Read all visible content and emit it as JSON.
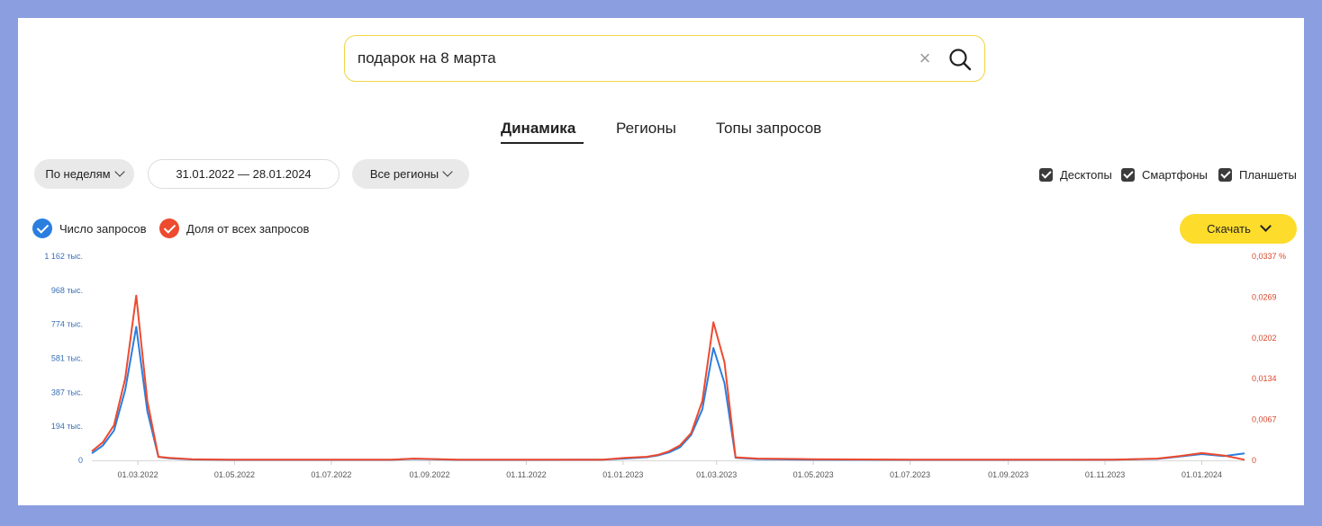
{
  "search": {
    "value": "подарок на 8 марта",
    "clear_symbol": "×"
  },
  "tabs": [
    {
      "label": "Динамика",
      "active": true
    },
    {
      "label": "Регионы",
      "active": false
    },
    {
      "label": "Топы запросов",
      "active": false
    }
  ],
  "filters": {
    "period_label": "По неделям",
    "date_range": "31.01.2022 — 28.01.2024",
    "region_label": "Все регионы"
  },
  "devices": [
    {
      "label": "Десктопы",
      "checked": true
    },
    {
      "label": "Смартфоны",
      "checked": true
    },
    {
      "label": "Планшеты",
      "checked": true
    }
  ],
  "legend": [
    {
      "label": "Число запросов",
      "color": "#2a7ee0"
    },
    {
      "label": "Доля от всех запросов",
      "color": "#ed4a2f"
    }
  ],
  "download_label": "Скачать",
  "chart_data": {
    "type": "line",
    "x_ticks": [
      "01.03.2022",
      "01.05.2022",
      "01.07.2022",
      "01.09.2022",
      "01.11.2022",
      "01.01.2023",
      "01.03.2023",
      "01.05.2023",
      "01.07.2023",
      "01.09.2023",
      "01.11.2023",
      "01.01.2024"
    ],
    "y_left_ticks": [
      "0",
      "194 тыс.",
      "387 тыс.",
      "581 тыс.",
      "774 тыс.",
      "968 тыс.",
      "1 162 тыс."
    ],
    "y_right_ticks": [
      "0",
      "0,0067",
      "0,0134",
      "0,0202",
      "0,0269",
      "0,0337 %"
    ],
    "y_left_range": [
      0,
      1162
    ],
    "y_right_range": [
      0,
      0.0337
    ],
    "x_range": [
      "2022-01-31",
      "2024-01-28"
    ],
    "series": [
      {
        "name": "Число запросов",
        "axis": "left",
        "color": "#2a7ee0",
        "x": [
          "2022-01-31",
          "2022-02-07",
          "2022-02-14",
          "2022-02-21",
          "2022-02-28",
          "2022-03-07",
          "2022-03-14",
          "2022-03-21",
          "2022-04-04",
          "2022-05-02",
          "2022-06-27",
          "2022-08-08",
          "2022-08-22",
          "2022-09-19",
          "2022-11-14",
          "2022-12-19",
          "2023-01-02",
          "2023-01-16",
          "2023-01-23",
          "2023-01-30",
          "2023-02-06",
          "2023-02-13",
          "2023-02-20",
          "2023-02-27",
          "2023-03-06",
          "2023-03-13",
          "2023-03-27",
          "2023-05-01",
          "2023-07-03",
          "2023-09-04",
          "2023-11-06",
          "2023-12-04",
          "2023-12-18",
          "2024-01-01",
          "2024-01-15",
          "2024-01-28"
        ],
        "values": [
          40,
          85,
          170,
          400,
          760,
          280,
          20,
          12,
          5,
          3,
          3,
          3,
          8,
          3,
          3,
          4,
          10,
          18,
          28,
          45,
          75,
          145,
          290,
          640,
          440,
          15,
          7,
          4,
          3,
          3,
          4,
          8,
          22,
          36,
          24,
          40
        ]
      },
      {
        "name": "Доля от всех запросов",
        "axis": "right",
        "color": "#ed4a2f",
        "x": [
          "2022-01-31",
          "2022-02-07",
          "2022-02-14",
          "2022-02-21",
          "2022-02-28",
          "2022-03-07",
          "2022-03-14",
          "2022-03-21",
          "2022-04-04",
          "2022-05-02",
          "2022-06-27",
          "2022-08-08",
          "2022-08-22",
          "2022-09-19",
          "2022-11-14",
          "2022-12-19",
          "2023-01-02",
          "2023-01-16",
          "2023-01-23",
          "2023-01-30",
          "2023-02-06",
          "2023-02-13",
          "2023-02-20",
          "2023-02-27",
          "2023-03-06",
          "2023-03-13",
          "2023-03-27",
          "2023-05-01",
          "2023-07-03",
          "2023-09-04",
          "2023-11-06",
          "2023-12-04",
          "2023-12-18",
          "2024-01-01",
          "2024-01-15",
          "2024-01-28"
        ],
        "values": [
          0.0015,
          0.003,
          0.0058,
          0.0135,
          0.0272,
          0.0098,
          0.0006,
          0.0004,
          0.0002,
          0.0001,
          0.0001,
          0.0001,
          0.0003,
          0.0001,
          0.0001,
          0.0001,
          0.0004,
          0.0006,
          0.0009,
          0.0015,
          0.0025,
          0.0045,
          0.0098,
          0.0228,
          0.0162,
          0.0005,
          0.0003,
          0.0002,
          0.0001,
          0.0001,
          0.0001,
          0.0003,
          0.0007,
          0.0012,
          0.0008,
          0.0001
        ]
      }
    ],
    "grid": false,
    "legend": "top-left"
  }
}
